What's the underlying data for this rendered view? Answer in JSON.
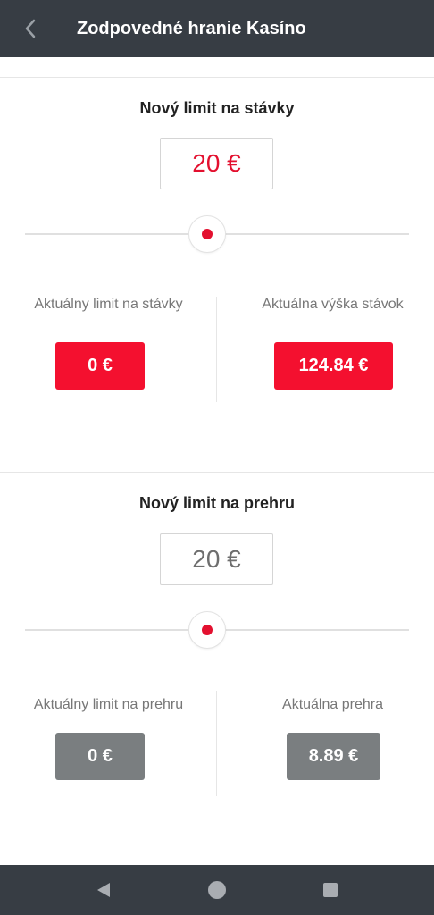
{
  "header": {
    "title": "Zodpovedné hranie Kasíno"
  },
  "bet_limit": {
    "title": "Nový limit na stávky",
    "amount": "20 €",
    "current_limit_label": "Aktuálny limit na stávky",
    "current_limit_value": "0 €",
    "current_amount_label": "Aktuálna výška stávok",
    "current_amount_value": "124.84 €"
  },
  "loss_limit": {
    "title": "Nový limit na prehru",
    "amount": "20 €",
    "current_limit_label": "Aktuálny limit na prehru",
    "current_limit_value": "0 €",
    "current_loss_label": "Aktuálna prehra",
    "current_loss_value": "8.89 €"
  },
  "colors": {
    "accent": "#e3102f",
    "header_bg": "#373d44",
    "badge_gray": "#7a7e80"
  },
  "icons": {
    "back": "chevron-left-icon",
    "nav_back": "triangle-back-icon",
    "nav_home": "circle-home-icon",
    "nav_recents": "square-recents-icon"
  }
}
